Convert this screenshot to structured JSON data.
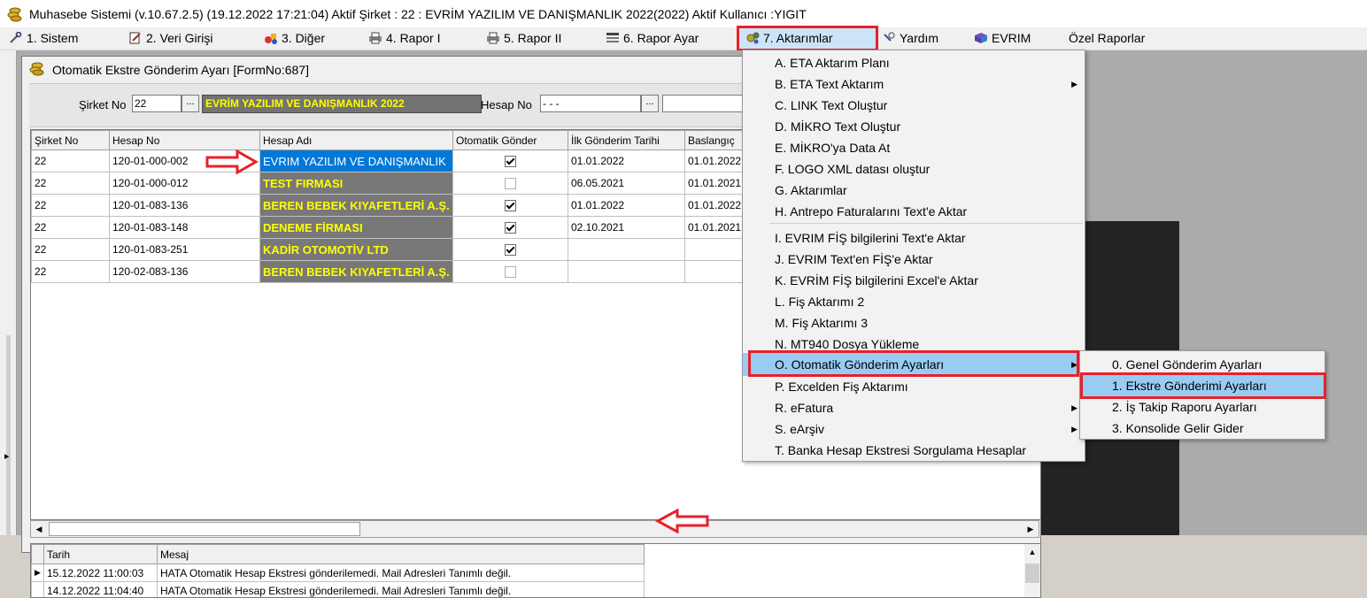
{
  "app": {
    "title": "Muhasebe Sistemi (v.10.67.2.5) (19.12.2022 17:21:04) Aktif Şirket : 22 : EVRİM YAZILIM  VE DANIŞMANLIK 2022(2022) Aktif Kullanıcı :YIGIT"
  },
  "menubar": [
    {
      "label": "1.  Sistem",
      "icon": "tools-icon"
    },
    {
      "label": "2.  Veri Girişi",
      "icon": "notepad-icon"
    },
    {
      "label": "3.  Diğer",
      "icon": "shapes-icon"
    },
    {
      "label": "4.  Rapor I",
      "icon": "printer-icon"
    },
    {
      "label": "5.  Rapor II",
      "icon": "printer-icon"
    },
    {
      "label": "6.  Rapor Ayar",
      "icon": "list-icon"
    },
    {
      "label": "7.  Aktarımlar",
      "icon": "gears-icon"
    },
    {
      "label": "Yardım",
      "icon": "help-icon"
    },
    {
      "label": "EVRIM",
      "icon": "book-icon"
    },
    {
      "label": "Özel Raporlar",
      "icon": ""
    }
  ],
  "form": {
    "title": "Otomatik Ekstre Gönderim Ayarı [FormNo:687]",
    "sirket_label": "Şirket No",
    "sirket_value": "22",
    "sirket_name": "EVRİM YAZILIM  VE DANIŞMANLIK 2022",
    "hesap_label": "Hesap No",
    "hesap_value": " -  -  - ",
    "browse": "..."
  },
  "grid": {
    "columns": [
      "Şirket No",
      "Hesap No",
      "Hesap Adı",
      "Otomatik Gönder",
      "İlk Gönderim Tarihi",
      "Baslangıç"
    ],
    "rows": [
      {
        "sirket": "22",
        "hesap": "120-01-000-002",
        "ad": "EVRIM YAZILIM VE DANIŞMANLIK",
        "oto": true,
        "ilk": "01.01.2022",
        "bas": "01.01.2022"
      },
      {
        "sirket": "22",
        "hesap": "120-01-000-012",
        "ad": "TEST FIRMASI",
        "oto": false,
        "ilk": "06.05.2021",
        "bas": "01.01.2021"
      },
      {
        "sirket": "22",
        "hesap": "120-01-083-136",
        "ad": "BEREN BEBEK KIYAFETLERİ A.Ş.",
        "oto": true,
        "ilk": "01.01.2022",
        "bas": "01.01.2022"
      },
      {
        "sirket": "22",
        "hesap": "120-01-083-148",
        "ad": "DENEME FİRMASI",
        "oto": true,
        "ilk": "02.10.2021",
        "bas": "01.01.2021"
      },
      {
        "sirket": "22",
        "hesap": "120-01-083-251",
        "ad": "KADİR OTOMOTİV LTD",
        "oto": true,
        "ilk": "",
        "bas": ""
      },
      {
        "sirket": "22",
        "hesap": "120-02-083-136",
        "ad": "BEREN BEBEK KIYAFETLERİ A.Ş.",
        "oto": false,
        "ilk": "",
        "bas": ""
      }
    ]
  },
  "log": {
    "columns": [
      "Tarih",
      "Mesaj"
    ],
    "rows": [
      {
        "tarih": "15.12.2022 11:00:03",
        "mesaj": "HATA Otomatik Hesap Ekstresi gönderilemedi. Mail Adresleri Tanımlı değil."
      },
      {
        "tarih": "14.12.2022 11:04:40",
        "mesaj": "HATA Otomatik Hesap Ekstresi gönderilemedi. Mail Adresleri Tanımlı değil."
      }
    ]
  },
  "aktarimlar_menu": [
    {
      "label": "A.  ETA Aktarım Planı",
      "sub": false
    },
    {
      "label": "B.  ETA Text Aktarım",
      "sub": true
    },
    {
      "label": "C.  LINK Text Oluştur",
      "sub": false
    },
    {
      "label": "D.  MİKRO Text Oluştur",
      "sub": false
    },
    {
      "label": "E.  MİKRO'ya  Data  At",
      "sub": false
    },
    {
      "label": "F.  LOGO XML datası oluştur",
      "sub": false
    },
    {
      "label": "G.  Aktarımlar",
      "sub": false
    },
    {
      "label": "H.  Antrepo Faturalarını Text'e Aktar",
      "sub": false
    },
    {
      "label": "I.  EVRIM FİŞ bilgilerini Text'e Aktar",
      "sub": false
    },
    {
      "label": "J.  EVRIM Text'en FİŞ'e Aktar",
      "sub": false
    },
    {
      "label": "K.   EVRİM FİŞ bilgilerini Excel'e Aktar",
      "sub": false
    },
    {
      "label": "L.   Fiş Aktarımı 2",
      "sub": false
    },
    {
      "label": "M.   Fiş Aktarımı 3",
      "sub": false
    },
    {
      "label": "N.   MT940 Dosya Yükleme",
      "sub": false
    },
    {
      "label": "O. Otomatik Gönderim Ayarları",
      "sub": true
    },
    {
      "label": "P.   Excelden Fiş Aktarımı",
      "sub": false
    },
    {
      "label": "R. eFatura",
      "sub": true
    },
    {
      "label": "S.   eArşiv",
      "sub": true
    },
    {
      "label": "T. Banka Hesap Ekstresi Sorgulama Hesaplar",
      "sub": false
    }
  ],
  "otomatik_submenu": [
    {
      "label": "0. Genel Gönderim Ayarları"
    },
    {
      "label": "1. Ekstre Gönderimi Ayarları"
    },
    {
      "label": "2. İş Takip Raporu Ayarları"
    },
    {
      "label": "3. Konsolide Gelir Gider"
    }
  ],
  "colors": {
    "highlight_red": "#e8202a",
    "menu_highlight": "#99ccf3",
    "selection_blue": "#0078d7",
    "name_cell_bg": "#787878",
    "name_cell_text": "#ffff00"
  }
}
